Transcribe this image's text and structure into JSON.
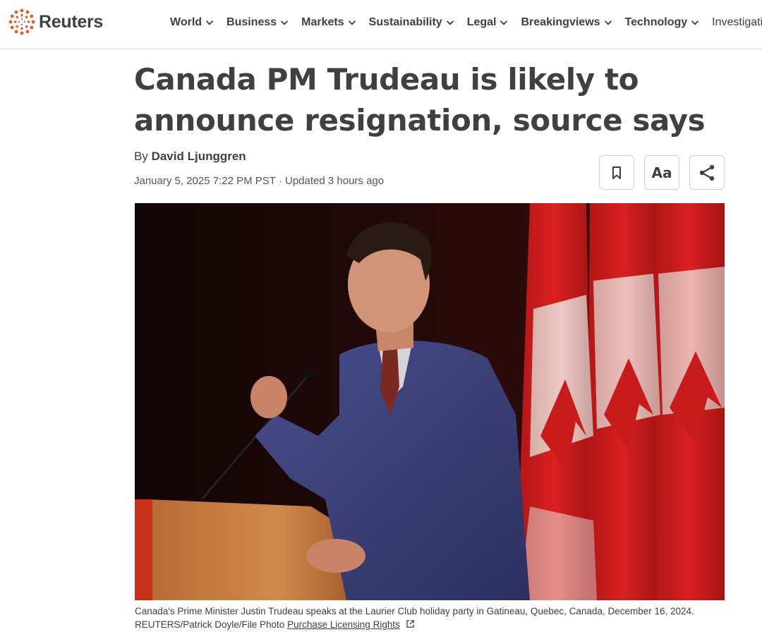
{
  "header": {
    "logo_text": "Reuters",
    "brand_color": "#e05a2b",
    "nav": [
      {
        "label": "World",
        "has_dropdown": true
      },
      {
        "label": "Business",
        "has_dropdown": true
      },
      {
        "label": "Markets",
        "has_dropdown": true
      },
      {
        "label": "Sustainability",
        "has_dropdown": true
      },
      {
        "label": "Legal",
        "has_dropdown": true
      },
      {
        "label": "Breakingviews",
        "has_dropdown": true
      },
      {
        "label": "Technology",
        "has_dropdown": true
      },
      {
        "label": "Investigations",
        "has_dropdown": false
      }
    ]
  },
  "article": {
    "headline": "Canada PM Trudeau is likely to announce resignation, source says",
    "byline_prefix": "By",
    "author": "David Ljunggren",
    "dateline": "January 5, 2025 7:22 PM PST · Updated 3 hours ago",
    "tools": {
      "bookmark_icon": "bookmark-icon",
      "text_size_label": "Aa",
      "share_icon": "share-icon"
    },
    "photo": {
      "flag_color": "#d8201f"
    },
    "caption": {
      "text": "Canada's Prime Minister Justin Trudeau speaks at the Laurier Club holiday party in Gatineau, Quebec, Canada, December 16, 2024.",
      "credit": "REUTERS/Patrick Doyle/File Photo",
      "licensing_link": "Purchase Licensing Rights",
      "licensing_icon": "external-link-icon"
    }
  }
}
